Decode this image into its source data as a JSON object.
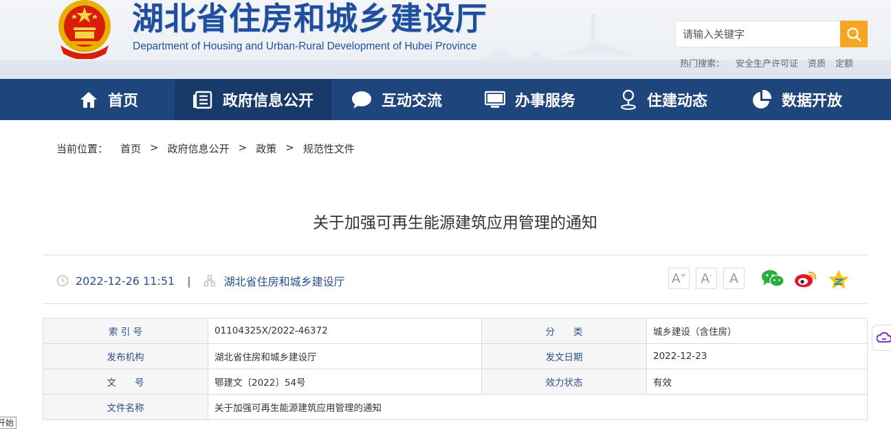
{
  "header": {
    "title": "湖北省住房和城乡建设厅",
    "subtitle": "Department of Housing and Urban-Rural Development of Hubei Province",
    "search_placeholder": "请输入关键字",
    "hot_label": "热门搜索：",
    "hot_links": [
      "安全生产许可证",
      "资质",
      "定额"
    ]
  },
  "nav": {
    "items": [
      {
        "label": "首页",
        "icon": "home-icon"
      },
      {
        "label": "政府信息公开",
        "icon": "document-list-icon"
      },
      {
        "label": "互动交流",
        "icon": "chat-bubble-icon"
      },
      {
        "label": "办事服务",
        "icon": "monitor-icon"
      },
      {
        "label": "住建动态",
        "icon": "person-pin-icon"
      },
      {
        "label": "数据开放",
        "icon": "pie-chart-icon"
      }
    ],
    "active_index": 1
  },
  "breadcrumb": {
    "label": "当前位置：",
    "items": [
      "首页",
      "政府信息公开",
      "政策",
      "规范性文件"
    ],
    "separator": ">"
  },
  "article": {
    "title": "关于加强可再生能源建筑应用管理的通知",
    "datetime": "2022-12-26 11:51",
    "meta_separator": "|",
    "source": "湖北省住房和城乡建设厅",
    "font_sizes": [
      "A",
      "A",
      "A"
    ],
    "share_icons": [
      "wechat-icon",
      "weibo-icon",
      "qzone-icon"
    ]
  },
  "info": {
    "rows": [
      {
        "k1": "索 引 号",
        "v1": "01104325X/2022-46372",
        "k2": "分　　类",
        "v2": "城乡建设（含住房）"
      },
      {
        "k1": "发布机构",
        "v1": "湖北省住房和城乡建设厅",
        "k2": "发文日期",
        "v2": "2022-12-23"
      },
      {
        "k1": "文　　号",
        "v1": "鄂建文〔2022〕54号",
        "k2": "效力状态",
        "v2": "有效"
      },
      {
        "k1": "文件名称",
        "v1": "关于加强可再生能源建筑应用管理的通知"
      }
    ]
  },
  "misc": {
    "bottom_tag": "开始"
  },
  "colors": {
    "nav_bg": "#1e467c",
    "nav_active": "#173a69",
    "brand_blue": "#1f4f9c",
    "search_orange": "#f5a623"
  }
}
